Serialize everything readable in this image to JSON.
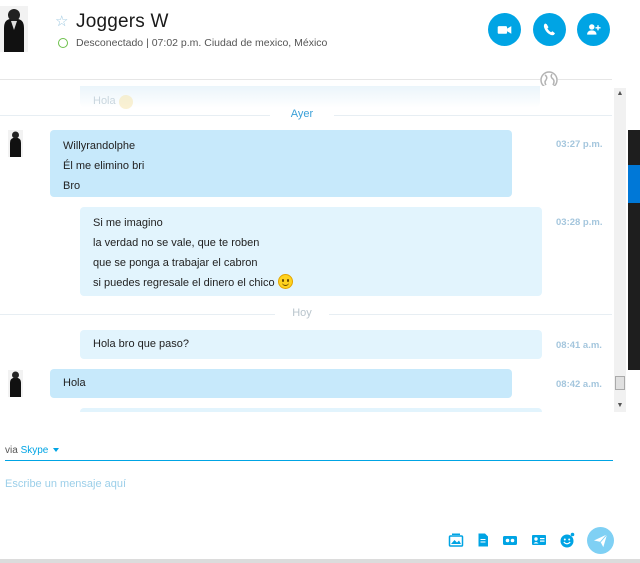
{
  "header": {
    "contact_name": "Joggers W",
    "presence": "Desconectado",
    "status_detail": "07:02 p.m. Ciudad de mexico, México",
    "separator": "|"
  },
  "chat": {
    "ghost_message": "Hola",
    "dividers": {
      "yesterday": "Ayer",
      "today": "Hoy"
    },
    "messages": [
      {
        "direction": "incoming",
        "lines": [
          "Willyrandolphe",
          "Él me elimino bri",
          "Bro"
        ],
        "time": "03:27 p.m."
      },
      {
        "direction": "outgoing",
        "lines": [
          "Si me imagino",
          "la verdad no se vale, que te roben",
          "que se ponga a trabajar el cabron",
          "si puedes regresale el dinero el chico"
        ],
        "time": "03:28 p.m.",
        "trailing_emoji": "smile-emoji"
      },
      {
        "direction": "outgoing",
        "lines": [
          "Hola bro que paso?"
        ],
        "time": "08:41 a.m."
      },
      {
        "direction": "incoming",
        "lines": [
          "Hola"
        ],
        "time": "08:42 a.m."
      }
    ]
  },
  "composer": {
    "via_label": "via",
    "via_service": "Skype",
    "placeholder": "Escribe un mensaje aquí",
    "value": ""
  },
  "toolbar": {
    "icons": [
      "send-image-icon",
      "send-file-icon",
      "video-message-icon",
      "send-contact-icon",
      "emoticon-icon",
      "send-icon"
    ]
  },
  "colors": {
    "accent": "#00a4e4",
    "incoming_bubble": "#c7e9fb",
    "outgoing_bubble": "#e2f4fd",
    "timestamp": "#a4c6dd",
    "presence_ring": "#6cc04a"
  }
}
